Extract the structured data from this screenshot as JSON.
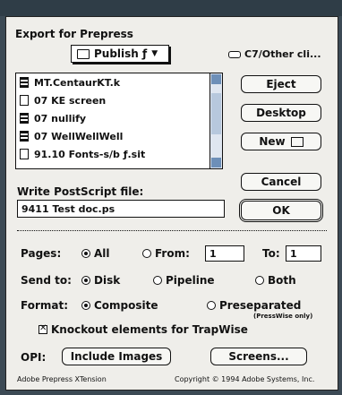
{
  "dialog": {
    "title": "Export for Prepress",
    "folder_popup": "Publish ƒ",
    "disk_name": "C7/Other cli...",
    "files": [
      {
        "name": "MT.CentaurKT.k",
        "icon": "app-icon"
      },
      {
        "name": "07 KE screen",
        "icon": "document-icon"
      },
      {
        "name": "07 nullify",
        "icon": "app-icon"
      },
      {
        "name": "07 WellWellWell",
        "icon": "app-icon"
      },
      {
        "name": "91.10 Fonts-s/b ƒ.sit",
        "icon": "document-icon"
      }
    ],
    "buttons": {
      "eject": "Eject",
      "desktop": "Desktop",
      "new": "New",
      "cancel": "Cancel",
      "ok": "OK"
    },
    "write_label": "Write PostScript file:",
    "filename": "9411 Test doc.ps",
    "pages": {
      "label": "Pages:",
      "all": "All",
      "from": "From:",
      "from_value": "1",
      "to": "To:",
      "to_value": "1"
    },
    "send_to": {
      "label": "Send to:",
      "disk": "Disk",
      "pipeline": "Pipeline",
      "both": "Both"
    },
    "format": {
      "label": "Format:",
      "composite": "Composite",
      "preseparated": "Preseparated",
      "note": "(PressWise only)"
    },
    "knockout": "Knockout elements for TrapWise",
    "opi": {
      "label": "OPI:",
      "include_images": "Include Images",
      "screens": "Screens..."
    },
    "footer_left": "Adobe Prepress XTension",
    "footer_right": "Copyright © 1994 Adobe Systems, Inc."
  }
}
